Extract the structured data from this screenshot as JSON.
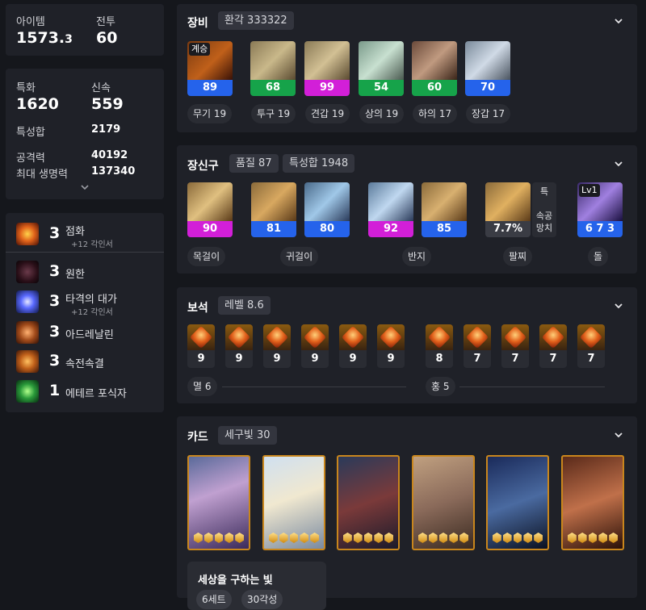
{
  "summary": {
    "item_level_label": "아이템",
    "item_level_int": "1573.",
    "item_level_dec": "3",
    "combat_label": "전투",
    "combat_value": "60"
  },
  "stats": {
    "spec_label": "특화",
    "spec_value": "1620",
    "swift_label": "신속",
    "swift_value": "559",
    "total_label": "특성합",
    "total_value": "2179",
    "atk_label": "공격력",
    "atk_value": "40192",
    "hp_label": "최대 생명력",
    "hp_value": "137340"
  },
  "engravings": [
    {
      "count": "3",
      "name": "점화",
      "sub": "+12 각인서",
      "icon": "ignite-icon"
    },
    {
      "count": "3",
      "name": "원한",
      "sub": "",
      "icon": "grudge-icon"
    },
    {
      "count": "3",
      "name": "타격의 대가",
      "sub": "+12 각인서",
      "icon": "hit-master-icon"
    },
    {
      "count": "3",
      "name": "아드레날린",
      "sub": "",
      "icon": "adrenaline-icon"
    },
    {
      "count": "3",
      "name": "속전속결",
      "sub": "",
      "icon": "all-out-icon"
    },
    {
      "count": "1",
      "name": "에테르 포식자",
      "sub": "",
      "icon": "ether-icon"
    }
  ],
  "equipment": {
    "title": "장비",
    "tag": "환각 333322",
    "succession_label": "계승",
    "items": [
      {
        "quality": "89",
        "label": "무기 19",
        "color": "#2563eb",
        "icon": "weapon-icon"
      },
      {
        "quality": "68",
        "label": "투구 19",
        "color": "#16a34a",
        "icon": "helmet-icon"
      },
      {
        "quality": "99",
        "label": "견갑 19",
        "color": "#d21fd8",
        "icon": "shoulder-icon"
      },
      {
        "quality": "54",
        "label": "상의 19",
        "color": "#16a34a",
        "icon": "chest-icon"
      },
      {
        "quality": "60",
        "label": "하의 17",
        "color": "#16a34a",
        "icon": "pants-icon"
      },
      {
        "quality": "70",
        "label": "장갑 17",
        "color": "#2563eb",
        "icon": "gloves-icon"
      }
    ]
  },
  "accessories": {
    "title": "장신구",
    "quality_tag": "품질 87",
    "stat_tag": "특성합 1948",
    "items": [
      {
        "value": "90",
        "color": "#d21fd8",
        "icon": "necklace-icon"
      },
      {
        "value": "81",
        "color": "#2563eb",
        "icon": "earring-icon"
      },
      {
        "value": "80",
        "color": "#2563eb",
        "icon": "earring-icon"
      },
      {
        "value": "92",
        "color": "#d21fd8",
        "icon": "ring-icon"
      },
      {
        "value": "85",
        "color": "#2563eb",
        "icon": "ring-icon"
      },
      {
        "value": "7.7%",
        "color": "#3a3c44",
        "icon": "bracelet-icon"
      },
      {
        "value": "6 7 3",
        "color": "#2563eb",
        "icon": "stone-icon"
      }
    ],
    "labels": {
      "necklace": "목걸이",
      "earring": "귀걸이",
      "ring": "반지",
      "bracelet": "팔찌",
      "stone": "돌"
    },
    "bracelet_effects": [
      "특",
      "속공",
      "망치"
    ],
    "stone_level": "Lv1"
  },
  "gems": {
    "title": "보석",
    "tag": "레벨 8.6",
    "left_levels": [
      "9",
      "9",
      "9",
      "9",
      "9",
      "9"
    ],
    "right_levels": [
      "8",
      "7",
      "7",
      "7",
      "7"
    ],
    "left_label": "멸 6",
    "right_label": "홍 5"
  },
  "cards": {
    "title": "카드",
    "tag": "세구빛 30",
    "set_title": "세상을 구하는 빛",
    "set_pills": [
      "6세트",
      "30각성"
    ],
    "awaken": [
      5,
      5,
      5,
      5,
      5,
      5
    ]
  }
}
